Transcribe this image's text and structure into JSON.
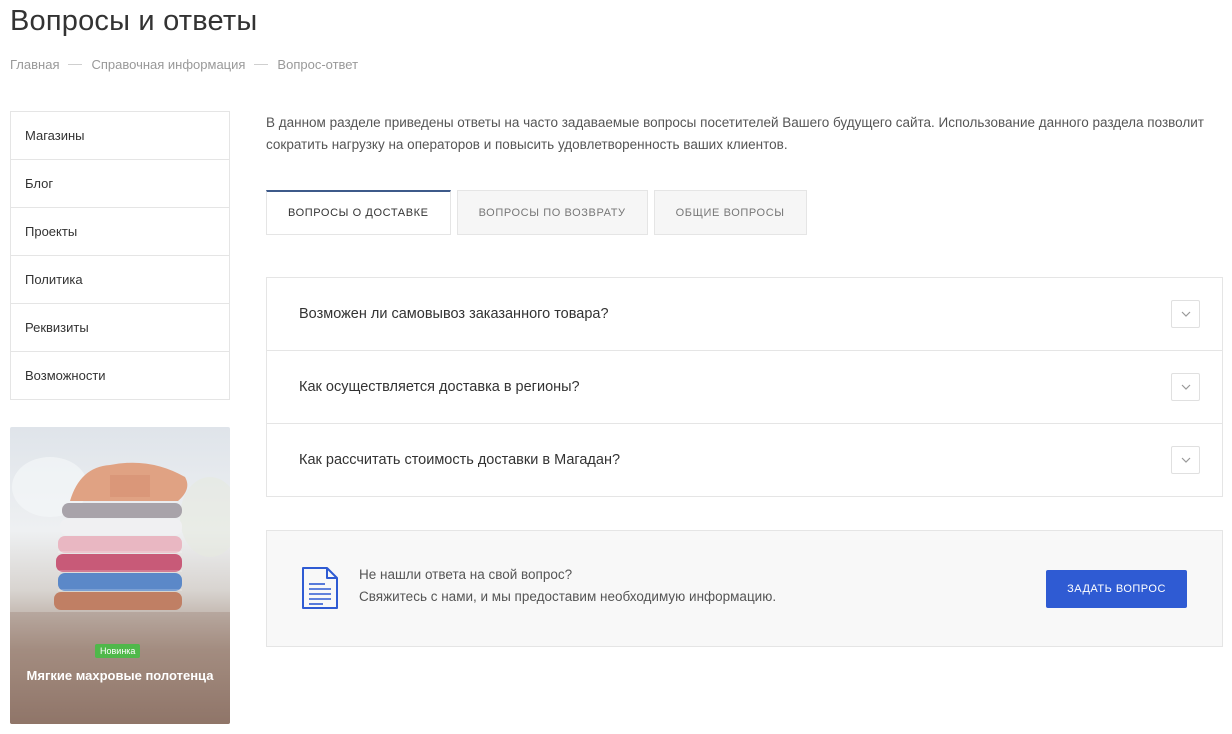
{
  "page": {
    "title": "Вопросы и ответы"
  },
  "breadcrumb": {
    "items": [
      "Главная",
      "Справочная информация",
      "Вопрос-ответ"
    ]
  },
  "sidebar": {
    "items": [
      {
        "label": "Магазины"
      },
      {
        "label": "Блог"
      },
      {
        "label": "Проекты"
      },
      {
        "label": "Политика"
      },
      {
        "label": "Реквизиты"
      },
      {
        "label": "Возможности"
      }
    ]
  },
  "promo": {
    "badge": "Новинка",
    "title": "Мягкие махровые полотенца",
    "badge_color": "#4fb84a"
  },
  "intro": {
    "text": "В данном разделе приведены ответы на часто задаваемые вопросы посетителей Вашего будущего сайта. Использование данного раздела позволит сократить нагрузку на операторов и повысить удовлетворенность ваших клиентов."
  },
  "tabs": [
    {
      "label": "Вопросы о доставке",
      "active": true
    },
    {
      "label": "Вопросы по возврату",
      "active": false
    },
    {
      "label": "Общие вопросы",
      "active": false
    }
  ],
  "faq": {
    "items": [
      {
        "question": "Возможен ли самовывоз заказанного товара?",
        "icon": "chevron-down-icon"
      },
      {
        "question": "Как осуществляется доставка в регионы?",
        "icon": "chevron-down-icon"
      },
      {
        "question": "Как рассчитать стоимость доставки в Магадан?",
        "icon": "chevron-down-icon"
      }
    ]
  },
  "cta": {
    "line1": "Не нашли ответа на свой вопрос?",
    "line2": "Свяжитесь с нами, и мы предоставим необходимую информацию.",
    "button_label": "Задать вопрос",
    "icon": "document-icon",
    "accent_color": "#2f5bd3"
  }
}
